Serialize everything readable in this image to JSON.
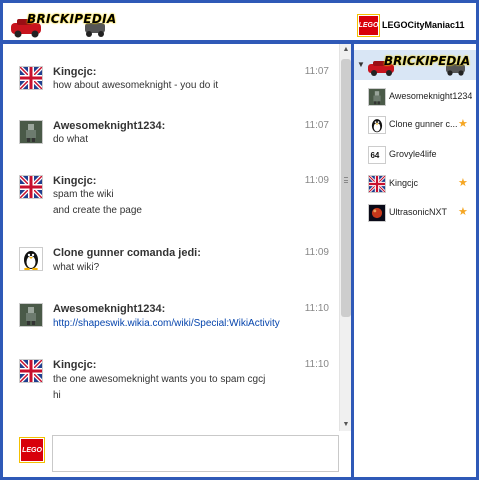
{
  "header": {
    "wiki_name": "BRICKIPEDIA",
    "current_user": "LEGOCityManiac11"
  },
  "brand": {
    "lego_text": "LEGO",
    "accent": "#2f59b7",
    "lego_red": "#d8000a",
    "link": "#0645ad",
    "star": "#f5a623"
  },
  "messages": [
    {
      "user": "Kingcjc:",
      "time": "11:07",
      "lines": [
        "how about awesomeknight - you do it"
      ],
      "avatar": "uk-flag-icon"
    },
    {
      "user": "Awesomeknight1234:",
      "time": "11:07",
      "lines": [
        "do what"
      ],
      "avatar": "knight-figure-icon"
    },
    {
      "user": "Kingcjc:",
      "time": "11:09",
      "lines": [
        "spam the wiki",
        "and create the page"
      ],
      "avatar": "uk-flag-icon"
    },
    {
      "user": "Clone gunner comanda jedi:",
      "time": "11:09",
      "lines": [
        "what wiki?"
      ],
      "avatar": "penguin-icon"
    },
    {
      "user": "Awesomeknight1234:",
      "time": "11:10",
      "lines": [
        "http://shapeswik.wikia.com/wiki/Special:WikiActivity"
      ],
      "avatar": "knight-figure-icon"
    },
    {
      "user": "Kingcjc:",
      "time": "11:10",
      "lines": [
        "the one awesomeknight wants you to spam cgcj",
        "hi"
      ],
      "avatar": "uk-flag-icon"
    }
  ],
  "sidebar": {
    "wiki_name": "BRICKIPEDIA",
    "users": [
      {
        "name": "Awesomeknight1234",
        "avatar": "knight-figure-icon",
        "star": false
      },
      {
        "name": "Clone gunner comanda jedi",
        "display": "Clone gunner c...",
        "avatar": "penguin-icon",
        "star": true
      },
      {
        "name": "Grovyle4life",
        "avatar": "grovyle-icon",
        "star": false
      },
      {
        "name": "Kingcjc",
        "avatar": "uk-flag-icon",
        "star": true
      },
      {
        "name": "UltrasonicNXT",
        "avatar": "planet-icon",
        "star": true
      }
    ]
  },
  "input": {
    "value": "",
    "placeholder": ""
  },
  "icons": {
    "star": "★",
    "collapse": "▼",
    "scroll_up": "▲",
    "scroll_down": "▼"
  }
}
